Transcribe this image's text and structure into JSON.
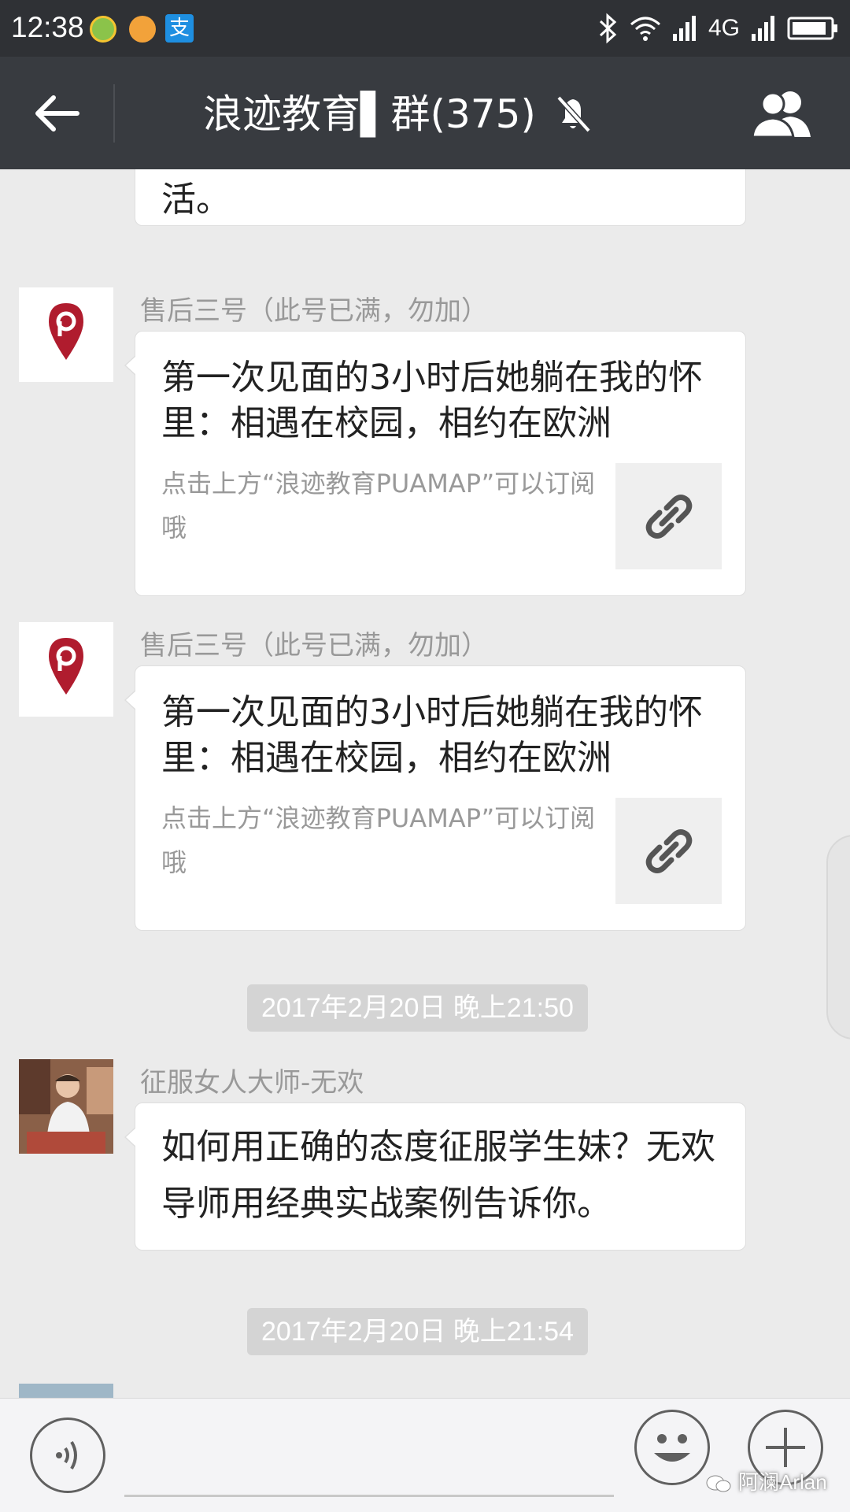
{
  "status_bar": {
    "time": "12:38",
    "network": "4G",
    "app_icons": [
      "add-icon",
      "paint-icon",
      "alipay-icon"
    ],
    "alipay_glyph": "支"
  },
  "title_bar": {
    "title": "浪迹教育▌群(375)",
    "back_icon": "back-arrow-icon",
    "mute_icon": "bell-muted-icon",
    "members_icon": "group-members-icon"
  },
  "messages": [
    {
      "type": "text-fragment",
      "text": "活。"
    },
    {
      "type": "link",
      "sender": "售后三号（此号已满，勿加）",
      "title": "第一次见面的3小时后她躺在我的怀里：相遇在校园，相约在欧洲",
      "description": "点击上方“浪迹教育PUAMAP”可以订阅哦",
      "thumb_icon": "link-icon"
    },
    {
      "type": "link",
      "sender": "售后三号（此号已满，勿加）",
      "title": "第一次见面的3小时后她躺在我的怀里：相遇在校园，相约在欧洲",
      "description": "点击上方“浪迹教育PUAMAP”可以订阅哦",
      "thumb_icon": "link-icon"
    },
    {
      "type": "timestamp",
      "text": "2017年2月20日 晚上21:50"
    },
    {
      "type": "text",
      "sender": "征服女人大师-无欢",
      "text": "如何用正确的态度征服学生妹？无欢导师用经典实战案例告诉你。"
    },
    {
      "type": "timestamp",
      "text": "2017年2月20日 晚上21:54"
    }
  ],
  "input_bar": {
    "voice_icon": "voice-icon",
    "emoji_icon": "emoji-icon",
    "plus_icon": "plus-icon",
    "text_value": ""
  },
  "watermark": "阿澜Arlan",
  "colors": {
    "status_bar": "#2f3135",
    "title_bar": "#383b40",
    "chat_bg": "#ebebeb",
    "timestamp_bg": "#d4d4d4",
    "avatar_pin": "#b01c2e"
  }
}
